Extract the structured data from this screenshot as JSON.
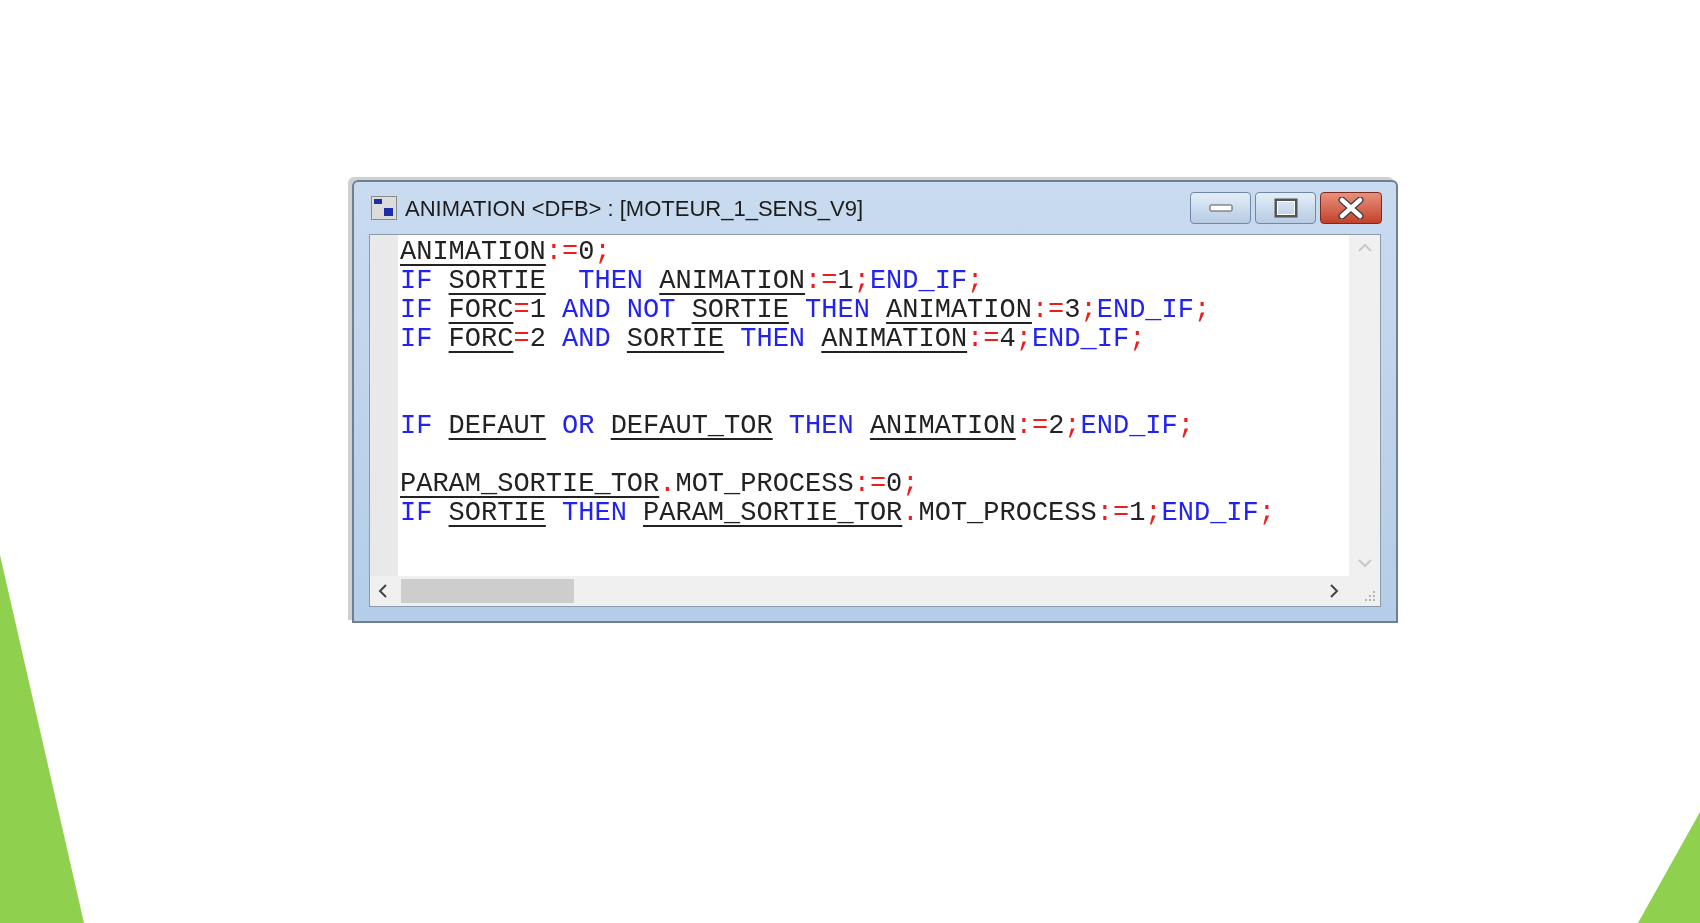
{
  "window": {
    "title": "ANIMATION <DFB> : [MOTEUR_1_SENS_V9]"
  },
  "code_lines": [
    {
      "tokens": [
        {
          "kind": "var",
          "text": "ANIMATION"
        },
        {
          "kind": "op",
          "text": ":="
        },
        {
          "kind": "plain",
          "text": "0"
        },
        {
          "kind": "op",
          "text": ";"
        }
      ]
    },
    {
      "tokens": [
        {
          "kind": "keyword",
          "text": "IF "
        },
        {
          "kind": "var",
          "text": "SORTIE"
        },
        {
          "kind": "keyword",
          "text": "  THEN "
        },
        {
          "kind": "var",
          "text": "ANIMATION"
        },
        {
          "kind": "op",
          "text": ":="
        },
        {
          "kind": "plain",
          "text": "1"
        },
        {
          "kind": "op",
          "text": ";"
        },
        {
          "kind": "keyword",
          "text": "END_IF"
        },
        {
          "kind": "op",
          "text": ";"
        }
      ]
    },
    {
      "tokens": [
        {
          "kind": "keyword",
          "text": "IF "
        },
        {
          "kind": "var",
          "text": "FORC"
        },
        {
          "kind": "op",
          "text": "="
        },
        {
          "kind": "plain",
          "text": "1 "
        },
        {
          "kind": "keyword",
          "text": "AND NOT "
        },
        {
          "kind": "var",
          "text": "SORTIE"
        },
        {
          "kind": "keyword",
          "text": " THEN "
        },
        {
          "kind": "var",
          "text": "ANIMATION"
        },
        {
          "kind": "op",
          "text": ":="
        },
        {
          "kind": "plain",
          "text": "3"
        },
        {
          "kind": "op",
          "text": ";"
        },
        {
          "kind": "keyword",
          "text": "END_IF"
        },
        {
          "kind": "op",
          "text": ";"
        }
      ]
    },
    {
      "tokens": [
        {
          "kind": "keyword",
          "text": "IF "
        },
        {
          "kind": "var",
          "text": "FORC"
        },
        {
          "kind": "op",
          "text": "="
        },
        {
          "kind": "plain",
          "text": "2 "
        },
        {
          "kind": "keyword",
          "text": "AND "
        },
        {
          "kind": "var",
          "text": "SORTIE"
        },
        {
          "kind": "keyword",
          "text": " THEN "
        },
        {
          "kind": "var",
          "text": "ANIMATION"
        },
        {
          "kind": "op",
          "text": ":="
        },
        {
          "kind": "plain",
          "text": "4"
        },
        {
          "kind": "op",
          "text": ";"
        },
        {
          "kind": "keyword",
          "text": "END_IF"
        },
        {
          "kind": "op",
          "text": ";"
        }
      ]
    },
    {
      "kind": "blank"
    },
    {
      "kind": "blank"
    },
    {
      "tokens": [
        {
          "kind": "keyword",
          "text": "IF "
        },
        {
          "kind": "var",
          "text": "DEFAUT"
        },
        {
          "kind": "keyword",
          "text": " OR "
        },
        {
          "kind": "var",
          "text": "DEFAUT_TOR"
        },
        {
          "kind": "keyword",
          "text": " THEN "
        },
        {
          "kind": "var",
          "text": "ANIMATION"
        },
        {
          "kind": "op",
          "text": ":="
        },
        {
          "kind": "plain",
          "text": "2"
        },
        {
          "kind": "op",
          "text": ";"
        },
        {
          "kind": "keyword",
          "text": "END_IF"
        },
        {
          "kind": "op",
          "text": ";"
        }
      ]
    },
    {
      "kind": "blank"
    },
    {
      "tokens": [
        {
          "kind": "var",
          "text": "PARAM_SORTIE_TOR"
        },
        {
          "kind": "op",
          "text": "."
        },
        {
          "kind": "plain",
          "text": "MOT_PROCESS"
        },
        {
          "kind": "op",
          "text": ":="
        },
        {
          "kind": "plain",
          "text": "0"
        },
        {
          "kind": "op",
          "text": ";"
        }
      ]
    },
    {
      "tokens": [
        {
          "kind": "keyword",
          "text": "IF "
        },
        {
          "kind": "var",
          "text": "SORTIE"
        },
        {
          "kind": "keyword",
          "text": " THEN "
        },
        {
          "kind": "var",
          "text": "PARAM_SORTIE_TOR"
        },
        {
          "kind": "op",
          "text": "."
        },
        {
          "kind": "plain",
          "text": "MOT_PROCESS"
        },
        {
          "kind": "op",
          "text": ":="
        },
        {
          "kind": "plain",
          "text": "1"
        },
        {
          "kind": "op",
          "text": ";"
        },
        {
          "kind": "keyword",
          "text": "END_IF"
        },
        {
          "kind": "op",
          "text": ";"
        }
      ]
    }
  ]
}
